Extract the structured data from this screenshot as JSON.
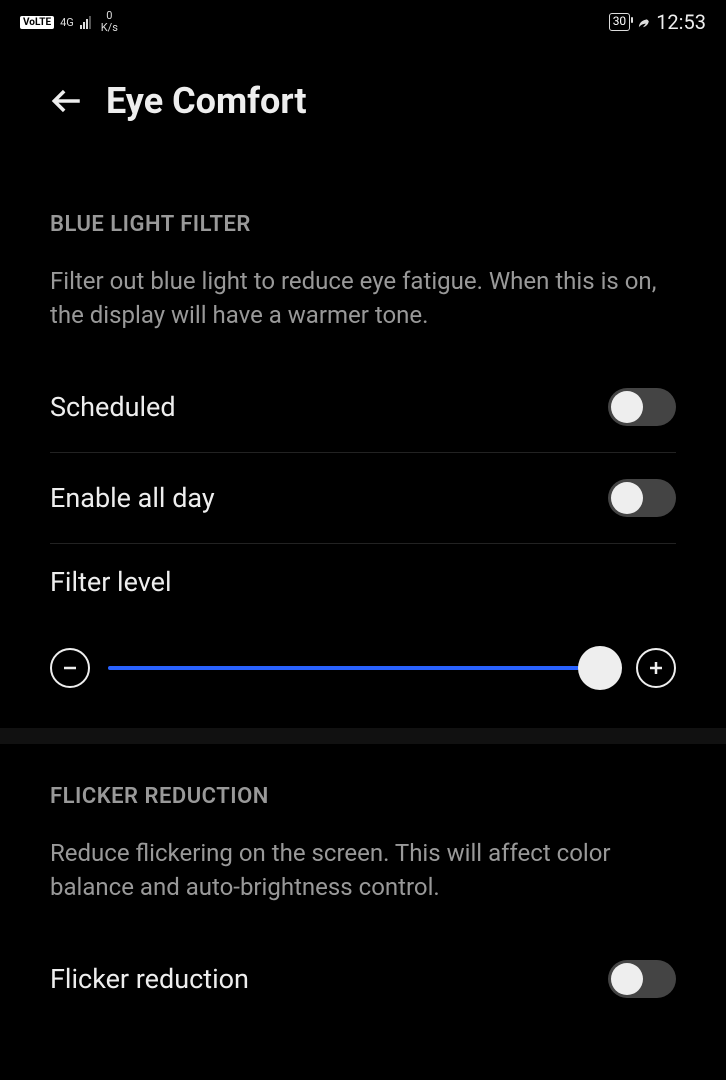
{
  "status": {
    "volte": "VoLTE",
    "network": "4G",
    "speedValue": "0",
    "speedUnit": "K/s",
    "battery": "30",
    "time": "12:53"
  },
  "header": {
    "title": "Eye Comfort"
  },
  "blueLight": {
    "sectionTitle": "BLUE LIGHT FILTER",
    "description": "Filter out blue light to reduce eye fatigue. When this is on, the display will have a warmer tone.",
    "scheduledLabel": "Scheduled",
    "enableAllDayLabel": "Enable all day",
    "filterLevelLabel": "Filter level"
  },
  "flicker": {
    "sectionTitle": "FLICKER REDUCTION",
    "description": "Reduce flickering on the screen. This will affect color balance and auto-brightness control.",
    "flickerLabel": "Flicker reduction"
  }
}
